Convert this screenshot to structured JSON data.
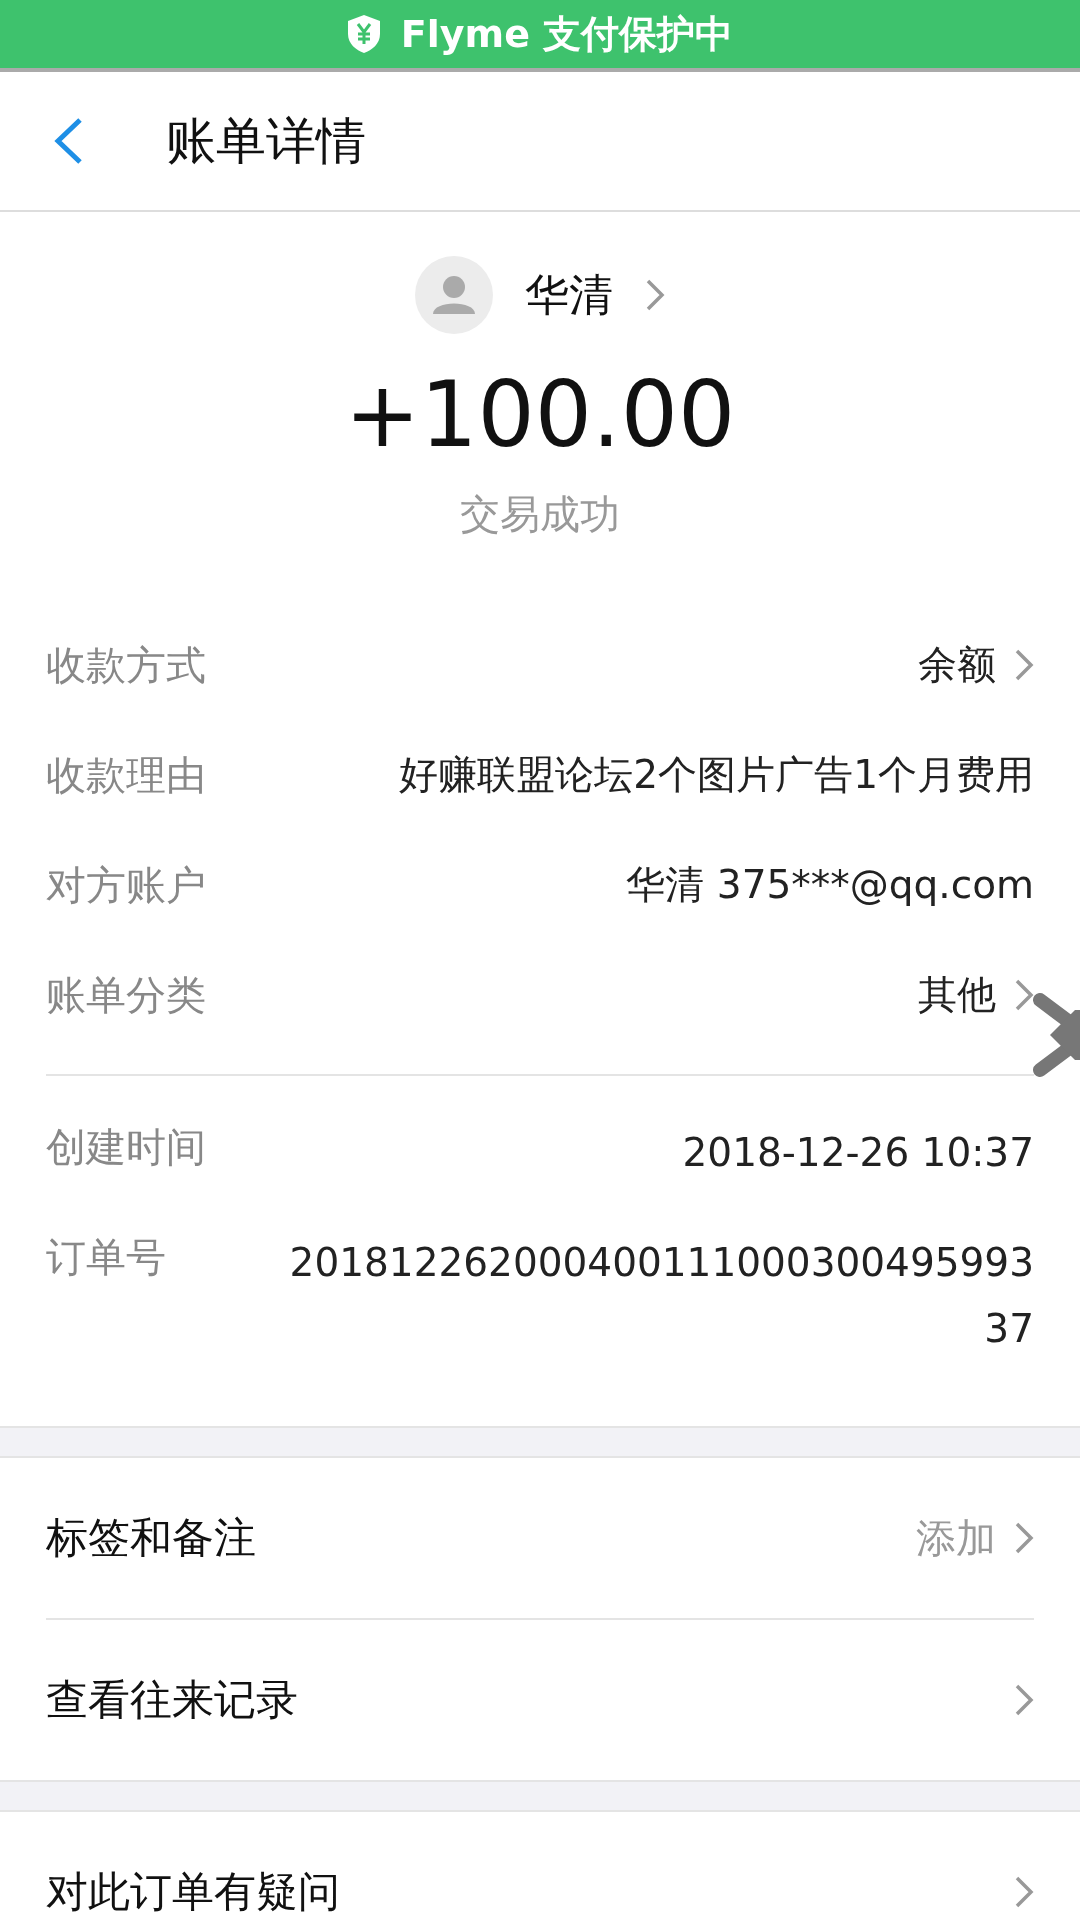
{
  "protection_bar": {
    "text": "Flyme 支付保护中"
  },
  "header": {
    "title": "账单详情"
  },
  "payer": {
    "name": "华清"
  },
  "amount": "+100.00",
  "status": "交易成功",
  "details": [
    {
      "label": "收款方式",
      "value": "余额",
      "has_arrow": true
    },
    {
      "label": "收款理由",
      "value": "好赚联盟论坛2个图片广告1个月费用",
      "has_arrow": false
    },
    {
      "label": "对方账户",
      "value": "华清 375***@qq.com",
      "has_arrow": false
    },
    {
      "label": "账单分类",
      "value": "其他",
      "has_arrow": true
    }
  ],
  "record": [
    {
      "label": "创建时间",
      "value": "2018-12-26 10:37"
    },
    {
      "label": "订单号",
      "value": "20181226200040011100030049599337"
    }
  ],
  "groups": [
    [
      {
        "label": "标签和备注",
        "value": "添加"
      },
      {
        "label": "查看往来记录"
      }
    ],
    [
      {
        "label": "对此订单有疑问"
      }
    ]
  ]
}
